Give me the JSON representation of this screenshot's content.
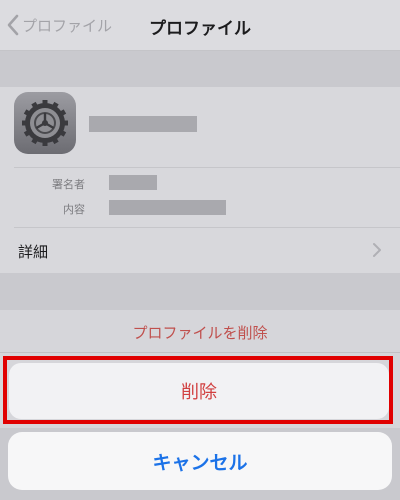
{
  "nav": {
    "back_label": "プロファイル",
    "title": "プロファイル"
  },
  "profile": {
    "icon": "settings-gear-icon",
    "signer_label": "署名者",
    "contents_label": "内容",
    "details_label": "詳細"
  },
  "action_sheet": {
    "title": "プロファイルを削除",
    "delete_label": "削除",
    "cancel_label": "キャンセル"
  },
  "colors": {
    "destructive": "#d14040",
    "accent": "#1b72e8",
    "highlight": "#e00000"
  }
}
